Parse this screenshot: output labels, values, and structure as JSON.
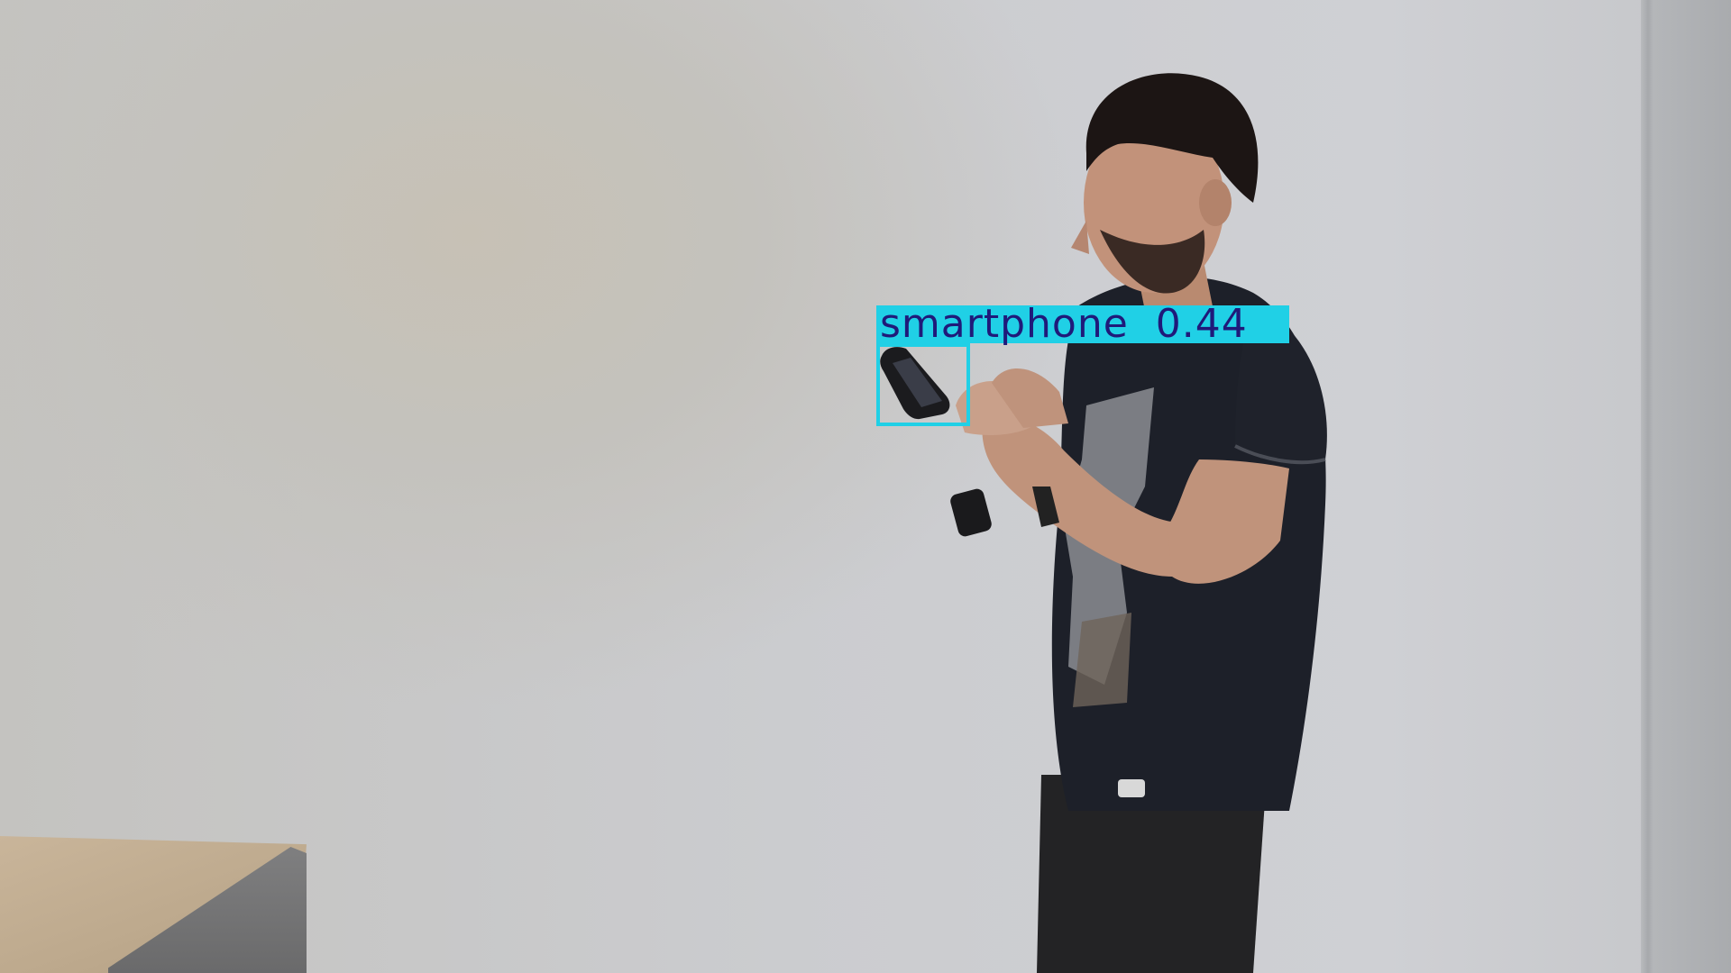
{
  "detection": {
    "label": "smartphone",
    "confidence": "0.44",
    "color": "#20d0e6",
    "text_color": "#1f1a7a"
  }
}
